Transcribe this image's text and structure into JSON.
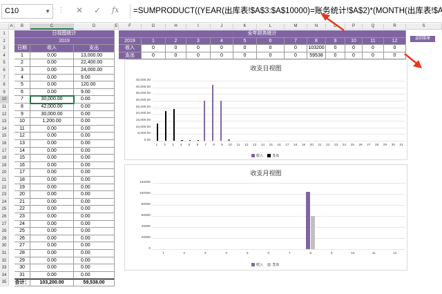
{
  "namebox": {
    "value": "C10"
  },
  "formula": {
    "text": "=SUMPRODUCT((YEAR(出库表!$A$3:$A$10000)=账务统计!$A$2)*(MONTH(出库表!$A$3:$A$"
  },
  "icons": {
    "cancel": "x-icon",
    "confirm": "check-icon",
    "fx": "fx"
  },
  "columns": [
    "A",
    "B",
    "C",
    "D",
    "E",
    "F",
    "G",
    "H",
    "I",
    "J",
    "K",
    "L",
    "M",
    "N",
    "O",
    "P",
    "Q",
    "R",
    "S"
  ],
  "selection_color": "#217346",
  "daily": {
    "title": "日视图统计",
    "year": "2019",
    "header": [
      "日期",
      "收入",
      "支出"
    ],
    "rows": [
      [
        "1",
        "0.00",
        "13,000.00"
      ],
      [
        "2",
        "0.00",
        "22,400.00"
      ],
      [
        "3",
        "0.00",
        "24,000.00"
      ],
      [
        "4",
        "0.00",
        "9.00"
      ],
      [
        "5",
        "0.00",
        "120.00"
      ],
      [
        "6",
        "0.00",
        "9.00"
      ],
      [
        "7",
        "30,000.00",
        "0.00"
      ],
      [
        "8",
        "42,000.00",
        "0.00"
      ],
      [
        "9",
        "30,000.00",
        "0.00"
      ],
      [
        "10",
        "1,200.00",
        "0.00"
      ],
      [
        "11",
        "0.00",
        "0.00"
      ],
      [
        "12",
        "0.00",
        "0.00"
      ],
      [
        "13",
        "0.00",
        "0.00"
      ],
      [
        "14",
        "0.00",
        "0.00"
      ],
      [
        "15",
        "0.00",
        "0.00"
      ],
      [
        "16",
        "0.00",
        "0.00"
      ],
      [
        "17",
        "0.00",
        "0.00"
      ],
      [
        "18",
        "0.00",
        "0.00"
      ],
      [
        "19",
        "0.00",
        "0.00"
      ],
      [
        "20",
        "0.00",
        "0.00"
      ],
      [
        "21",
        "0.00",
        "0.00"
      ],
      [
        "22",
        "0.00",
        "0.00"
      ],
      [
        "23",
        "0.00",
        "0.00"
      ],
      [
        "24",
        "0.00",
        "0.00"
      ],
      [
        "25",
        "0.00",
        "0.00"
      ],
      [
        "26",
        "0.00",
        "0.00"
      ],
      [
        "27",
        "0.00",
        "0.00"
      ],
      [
        "28",
        "0.00",
        "0.00"
      ],
      [
        "29",
        "0.00",
        "0.00"
      ],
      [
        "30",
        "0.00",
        "0.00"
      ],
      [
        "31",
        "0.00",
        "0.00"
      ]
    ],
    "total": [
      "合计：",
      "103,200.00",
      "59,538.00"
    ]
  },
  "annual": {
    "title": "全年财务统计",
    "year": "2019",
    "months": [
      "1",
      "2",
      "3",
      "4",
      "5",
      "6",
      "7",
      "8",
      "9",
      "10",
      "11",
      "12"
    ],
    "income_label": "收入",
    "expense_label": "支出",
    "income": [
      "0",
      "0",
      "0",
      "0",
      "0",
      "0",
      "0",
      "103200",
      "0",
      "0",
      "0",
      "0"
    ],
    "expense": [
      "0",
      "0",
      "0",
      "0",
      "0",
      "0",
      "0",
      "59538",
      "0",
      "0",
      "0",
      "0"
    ]
  },
  "menu_button": {
    "label": "返回菜单"
  },
  "colors": {
    "purple": "#8064a2",
    "income": "#8064a2",
    "expense_daily": "#000000",
    "expense_monthly": "#c0c0c0",
    "arrow": "#e8361c"
  },
  "chart_data": [
    {
      "type": "bar",
      "title": "收支日视图",
      "categories": [
        "1",
        "2",
        "3",
        "4",
        "5",
        "6",
        "7",
        "8",
        "9",
        "10",
        "11",
        "12",
        "13",
        "14",
        "15",
        "16",
        "17",
        "18",
        "19",
        "20",
        "21",
        "22",
        "23",
        "24",
        "25",
        "26",
        "27",
        "28",
        "29",
        "30",
        "31"
      ],
      "series": [
        {
          "name": "收入",
          "values": [
            0,
            0,
            0,
            0,
            0,
            0,
            30000,
            42000,
            30000,
            1200,
            0,
            0,
            0,
            0,
            0,
            0,
            0,
            0,
            0,
            0,
            0,
            0,
            0,
            0,
            0,
            0,
            0,
            0,
            0,
            0,
            0
          ]
        },
        {
          "name": "支出",
          "values": [
            13000,
            22400,
            24000,
            9,
            120,
            9,
            0,
            0,
            0,
            0,
            0,
            0,
            0,
            0,
            0,
            0,
            0,
            0,
            0,
            0,
            0,
            0,
            0,
            0,
            0,
            0,
            0,
            0,
            0,
            0,
            0
          ]
        }
      ],
      "ylim": [
        0,
        45000
      ],
      "yticks": [
        "0.00",
        "5,000.00",
        "10,000.00",
        "15,000.00",
        "20,000.00",
        "25,000.00",
        "30,000.00",
        "35,000.00",
        "40,000.00",
        "45,000.00"
      ],
      "legend": "bottom",
      "grid": true
    },
    {
      "type": "bar",
      "title": "收支月视图",
      "categories": [
        "1",
        "2",
        "3",
        "4",
        "5",
        "6",
        "7",
        "8",
        "9",
        "10",
        "11",
        "12"
      ],
      "series": [
        {
          "name": "收入",
          "values": [
            0,
            0,
            0,
            0,
            0,
            0,
            0,
            103200,
            0,
            0,
            0,
            0
          ]
        },
        {
          "name": "支出",
          "values": [
            0,
            0,
            0,
            0,
            0,
            0,
            0,
            59538,
            0,
            0,
            0,
            0
          ]
        }
      ],
      "ylim": [
        0,
        120000
      ],
      "yticks": [
        "0",
        "20000",
        "40000",
        "60000",
        "80000",
        "100000",
        "120000"
      ],
      "legend": "bottom",
      "grid": true
    }
  ]
}
